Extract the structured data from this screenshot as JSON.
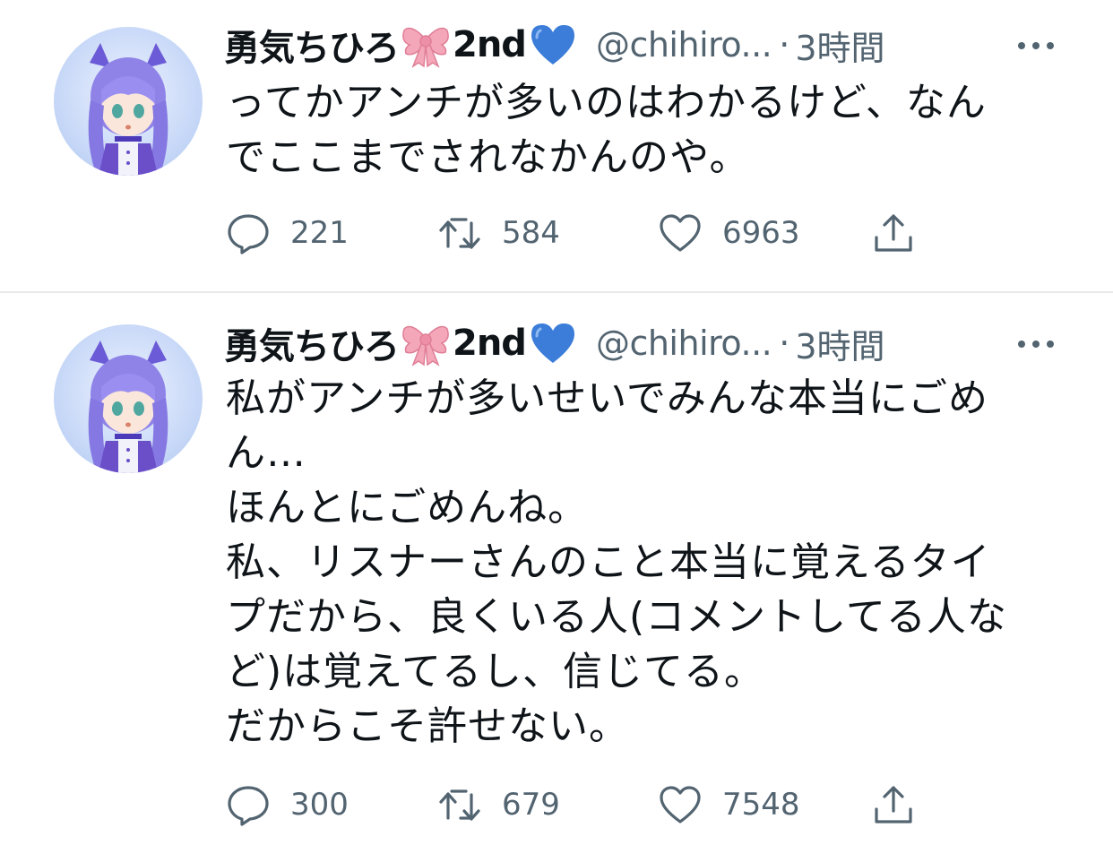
{
  "tweets": [
    {
      "display_name": "勇気ちひろ",
      "display_name_suffix": "2nd",
      "handle": "@chihiro...",
      "separator": "·",
      "time": "3時間",
      "text": "ってかアンチが多いのはわかるけど、なん\nでここまでされなかんのや。",
      "replies": "221",
      "retweets": "584",
      "likes": "6963",
      "icons": [
        "reply-icon",
        "retweet-icon",
        "like-icon",
        "share-icon",
        "more-icon"
      ]
    },
    {
      "display_name": "勇気ちひろ",
      "display_name_suffix": "2nd",
      "handle": "@chihiro...",
      "separator": "·",
      "time": "3時間",
      "text": "私がアンチが多いせいでみんな本当にごめ\nん…\nほんとにごめんね。\n私、リスナーさんのこと本当に覚えるタイ\nプだから、良くいる人(コメントしてる人な\nど)は覚えてるし、信じてる。\nだからこそ許せない。",
      "replies": "300",
      "retweets": "679",
      "likes": "7548",
      "icons": [
        "reply-icon",
        "retweet-icon",
        "like-icon",
        "share-icon",
        "more-icon"
      ]
    }
  ],
  "colors": {
    "text": "#0f1419",
    "secondary": "#536471",
    "divider": "#e7e9ea",
    "ribbon": "#f4a7b9",
    "heart": "#3b7dd8"
  }
}
